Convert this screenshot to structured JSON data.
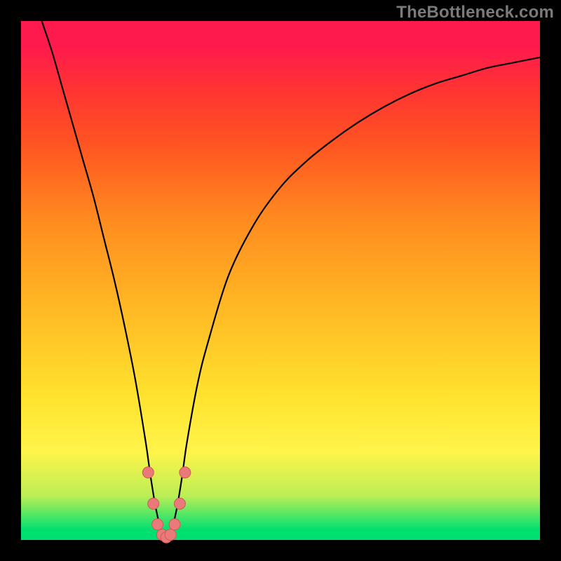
{
  "watermark": {
    "text": "TheBottleneck.com"
  },
  "colors": {
    "background": "#000000",
    "curve_stroke": "#000000",
    "marker_fill": "#e97a79",
    "marker_stroke": "#cf5a58"
  },
  "chart_data": {
    "type": "line",
    "title": "",
    "xlabel": "",
    "ylabel": "",
    "xlim": [
      0,
      100
    ],
    "ylim": [
      0,
      100
    ],
    "grid": false,
    "legend": false,
    "series": [
      {
        "name": "bottleneck-curve",
        "x": [
          4,
          6,
          8,
          10,
          12,
          14,
          16,
          18,
          20,
          22,
          24,
          25,
          26,
          27,
          28,
          29,
          30,
          31,
          32,
          34,
          36,
          40,
          45,
          50,
          55,
          60,
          65,
          70,
          75,
          80,
          85,
          90,
          95,
          100
        ],
        "y": [
          100,
          94,
          87,
          80,
          73,
          66,
          58,
          50,
          41,
          31,
          19,
          12,
          6,
          2,
          0.5,
          2,
          6,
          12,
          19,
          30,
          38,
          51,
          61,
          68,
          73,
          77,
          80.5,
          83.5,
          86,
          88,
          89.5,
          91,
          92,
          93
        ]
      }
    ],
    "markers": [
      {
        "x": 24.5,
        "y": 13
      },
      {
        "x": 25.5,
        "y": 7
      },
      {
        "x": 26.3,
        "y": 3
      },
      {
        "x": 27.2,
        "y": 1
      },
      {
        "x": 28.0,
        "y": 0.5
      },
      {
        "x": 28.8,
        "y": 1
      },
      {
        "x": 29.6,
        "y": 3
      },
      {
        "x": 30.6,
        "y": 7
      },
      {
        "x": 31.6,
        "y": 13
      }
    ],
    "annotations": []
  }
}
